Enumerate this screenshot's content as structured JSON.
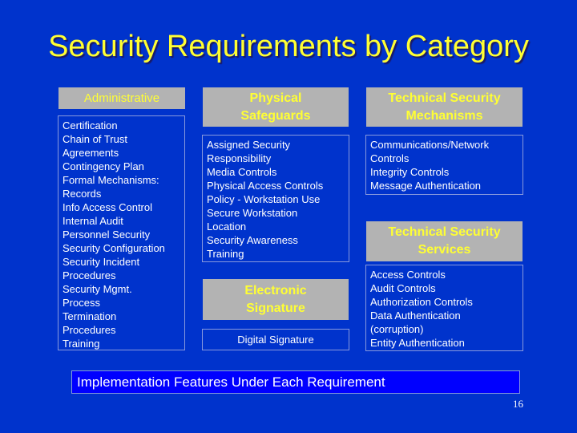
{
  "title": "Security Requirements by Category",
  "columns": {
    "administrative": {
      "header": "Administrative",
      "items": [
        "Certification",
        "Chain of Trust",
        "Agreements",
        "Contingency Plan",
        "Formal Mechanisms:",
        "Records",
        "Info Access Control",
        "Internal Audit",
        "Personnel Security",
        "Security Configuration",
        "Security Incident",
        "Procedures",
        "Security Mgmt.",
        "Process",
        "Termination",
        "Procedures",
        "Training"
      ]
    },
    "physical": {
      "header_line1": "Physical",
      "header_line2": "Safeguards",
      "items": [
        "Assigned Security",
        "Responsibility",
        "Media Controls",
        "Physical Access Controls",
        "Policy - Workstation Use",
        "Secure Workstation",
        "Location",
        "Security Awareness",
        "Training"
      ]
    },
    "electronic_signature": {
      "header_line1": "Electronic",
      "header_line2": "Signature",
      "items": [
        "Digital Signature"
      ]
    },
    "technical_mechanisms": {
      "header_line1": "Technical Security",
      "header_line2": "Mechanisms",
      "items": [
        "Communications/Network",
        "Controls",
        "Integrity Controls",
        "Message Authentication"
      ]
    },
    "technical_services": {
      "header_line1": "Technical Security",
      "header_line2": "Services",
      "items": [
        "Access Controls",
        "Audit Controls",
        "Authorization Controls",
        "Data Authentication",
        "(corruption)",
        "Entity Authentication"
      ]
    }
  },
  "footer": {
    "note": "Implementation Features Under Each Requirement",
    "page_number": "16"
  },
  "colors": {
    "background": "#0033cc",
    "title": "#ffff33",
    "header_bg": "#b3b3b3",
    "header_text": "#ffff33",
    "list_text": "#ffffff",
    "footer_bg": "#0000ff"
  }
}
